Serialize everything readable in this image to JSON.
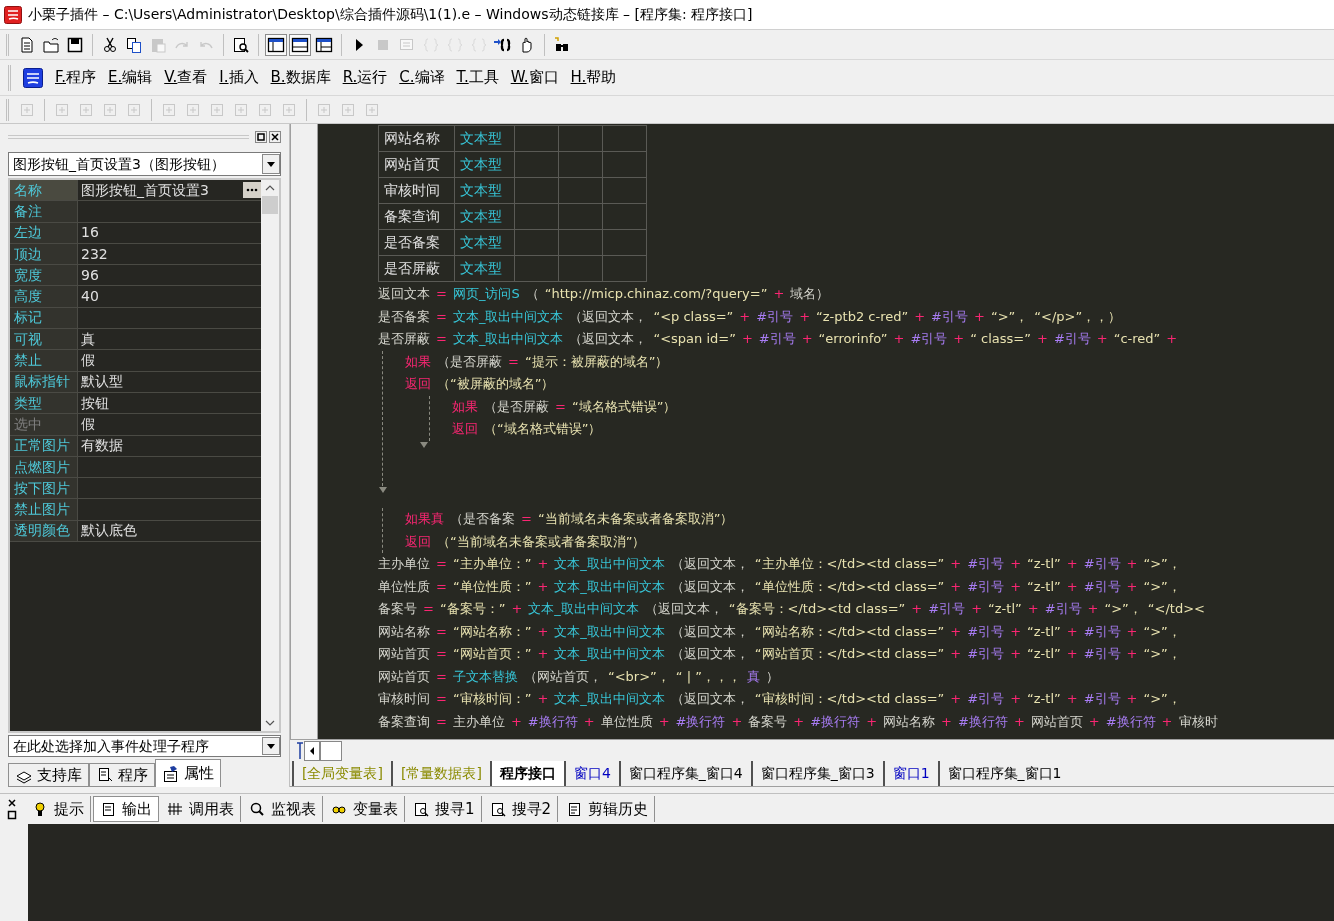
{
  "window": {
    "title": "小栗子插件 – C:\\Users\\Administrator\\Desktop\\综合插件源码\\1(1).e – Windows动态链接库 – [程序集: 程序接口]"
  },
  "toolbar": {
    "groups": [
      [
        {
          "disabled": false
        },
        {
          "disabled": false
        },
        {
          "disabled": false
        }
      ],
      [
        {
          "disabled": false
        },
        {
          "disabled": false
        },
        {
          "disabled": true
        },
        {
          "disabled": true
        },
        {
          "disabled": true
        }
      ],
      [
        {
          "disabled": false
        }
      ],
      [
        {
          "disabled": false,
          "selected": true
        },
        {
          "disabled": false,
          "selected": true
        },
        {
          "disabled": false,
          "selected": false
        }
      ],
      [
        {
          "disabled": false
        },
        {
          "disabled": true
        },
        {
          "disabled": true
        },
        {
          "disabled": true
        },
        {
          "disabled": true
        },
        {
          "disabled": true
        },
        {
          "disabled": false
        },
        {
          "disabled": false
        }
      ],
      [
        {
          "disabled": false
        }
      ]
    ]
  },
  "menu": [
    "F.程序",
    "E.编辑",
    "V.查看",
    "I.插入",
    "B.数据库",
    "R.运行",
    "C.编译",
    "T.工具",
    "W.窗口",
    "H.帮助"
  ],
  "align_toolbar": {
    "groups": [
      [
        {
          "disabled": true
        }
      ],
      [
        {
          "disabled": true
        },
        {
          "disabled": true
        },
        {
          "disabled": true
        },
        {
          "disabled": true
        }
      ],
      [
        {
          "disabled": true
        },
        {
          "disabled": true
        },
        {
          "disabled": true
        },
        {
          "disabled": true
        },
        {
          "disabled": true
        },
        {
          "disabled": true
        }
      ],
      [
        {
          "disabled": true
        },
        {
          "disabled": true
        },
        {
          "disabled": true
        }
      ]
    ]
  },
  "properties_panel": {
    "object_selector": "图形按钮_首页设置3（图形按钮）",
    "rows": [
      {
        "name": "名称",
        "value": "图形按钮_首页设置3",
        "disabled": false,
        "selected": true,
        "ellipsis": true
      },
      {
        "name": "备注",
        "value": "",
        "disabled": false,
        "selected": false
      },
      {
        "name": "左边",
        "value": "16",
        "disabled": false,
        "selected": false
      },
      {
        "name": "顶边",
        "value": "232",
        "disabled": false,
        "selected": false
      },
      {
        "name": "宽度",
        "value": "96",
        "disabled": false,
        "selected": false
      },
      {
        "name": "高度",
        "value": "40",
        "disabled": false,
        "selected": false
      },
      {
        "name": "标记",
        "value": "",
        "disabled": false,
        "selected": false
      },
      {
        "name": "可视",
        "value": "真",
        "disabled": false,
        "selected": false
      },
      {
        "name": "禁止",
        "value": "假",
        "disabled": false,
        "selected": false
      },
      {
        "name": "鼠标指针",
        "value": "默认型",
        "disabled": false,
        "selected": false
      },
      {
        "name": "类型",
        "value": "按钮",
        "disabled": false,
        "selected": false
      },
      {
        "name": "选中",
        "value": "假",
        "disabled": true,
        "selected": false
      },
      {
        "name": "正常图片",
        "value": "有数据",
        "disabled": false,
        "selected": false
      },
      {
        "name": "点燃图片",
        "value": "",
        "disabled": false,
        "selected": false
      },
      {
        "name": "按下图片",
        "value": "",
        "disabled": false,
        "selected": false
      },
      {
        "name": "禁止图片",
        "value": "",
        "disabled": false,
        "selected": false
      },
      {
        "name": "透明颜色",
        "value": "默认底色",
        "disabled": false,
        "selected": false
      }
    ],
    "event_selector": "在此处选择加入事件处理子程序",
    "tabs": [
      {
        "label": "支持库",
        "selected": false
      },
      {
        "label": "程序",
        "selected": false
      },
      {
        "label": "属性",
        "selected": true
      }
    ]
  },
  "editor": {
    "table": {
      "rows": [
        {
          "name": "网站名称",
          "type": "文本型"
        },
        {
          "name": "网站首页",
          "type": "文本型"
        },
        {
          "name": "审核时间",
          "type": "文本型"
        },
        {
          "name": "备案查询",
          "type": "文本型"
        },
        {
          "name": "是否备案",
          "type": "文本型"
        },
        {
          "name": "是否屏蔽",
          "type": "文本型"
        }
      ]
    },
    "lines": [
      {
        "kind": "stmt",
        "tokens": [
          {
            "kind": "plain",
            "text": "返回文本"
          },
          {
            "kind": "op",
            "text": "="
          },
          {
            "kind": "func",
            "text": "网页_访问S"
          },
          {
            "kind": "plain",
            "text": "（"
          },
          {
            "kind": "str",
            "text": "“http://micp.chinaz.com/?query=”"
          },
          {
            "kind": "op",
            "text": "+"
          },
          {
            "kind": "plain",
            "text": "域名）"
          }
        ]
      },
      {
        "kind": "stmt",
        "tokens": [
          {
            "kind": "plain",
            "text": "是否备案"
          },
          {
            "kind": "op",
            "text": "="
          },
          {
            "kind": "func",
            "text": "文本_取出中间文本"
          },
          {
            "kind": "plain",
            "text": "（返回文本，"
          },
          {
            "kind": "str",
            "text": "“<p class=”"
          },
          {
            "kind": "op",
            "text": "+"
          },
          {
            "kind": "const",
            "text": "#引号"
          },
          {
            "kind": "op",
            "text": "+"
          },
          {
            "kind": "str",
            "text": "“z-ptb2 c-red”"
          },
          {
            "kind": "op",
            "text": "+"
          },
          {
            "kind": "const",
            "text": "#引号"
          },
          {
            "kind": "op",
            "text": "+"
          },
          {
            "kind": "str",
            "text": "“>”，"
          },
          {
            "kind": "str",
            "text": "“</p>”，，）"
          }
        ]
      },
      {
        "kind": "stmt",
        "tokens": [
          {
            "kind": "plain",
            "text": "是否屏蔽"
          },
          {
            "kind": "op",
            "text": "="
          },
          {
            "kind": "func",
            "text": "文本_取出中间文本"
          },
          {
            "kind": "plain",
            "text": "（返回文本，"
          },
          {
            "kind": "str",
            "text": "“<span id=”"
          },
          {
            "kind": "op",
            "text": "+"
          },
          {
            "kind": "const",
            "text": "#引号"
          },
          {
            "kind": "op",
            "text": "+"
          },
          {
            "kind": "str",
            "text": "“errorinfo”"
          },
          {
            "kind": "op",
            "text": "+"
          },
          {
            "kind": "const",
            "text": "#引号"
          },
          {
            "kind": "op",
            "text": "+"
          },
          {
            "kind": "str",
            "text": "“ class=”"
          },
          {
            "kind": "op",
            "text": "+"
          },
          {
            "kind": "const",
            "text": "#引号"
          },
          {
            "kind": "op",
            "text": "+"
          },
          {
            "kind": "str",
            "text": "“c-red”"
          },
          {
            "kind": "op",
            "text": "+"
          }
        ]
      },
      {
        "kind": "if",
        "tokens": [
          {
            "kind": "kw",
            "text": "如果"
          },
          {
            "kind": "plain",
            "text": "（是否屏蔽"
          },
          {
            "kind": "op",
            "text": "="
          },
          {
            "kind": "str",
            "text": "“提示：被屏蔽的域名”）"
          }
        ],
        "then": [
          {
            "kind": "stmt",
            "tokens": [
              {
                "kind": "kw",
                "text": "返回"
              },
              {
                "kind": "str",
                "text": "（“被屏蔽的域名”）"
              }
            ]
          }
        ],
        "else": [
          {
            "kind": "if",
            "tokens": [
              {
                "kind": "kw",
                "text": "如果"
              },
              {
                "kind": "plain",
                "text": "（是否屏蔽"
              },
              {
                "kind": "op",
                "text": "="
              },
              {
                "kind": "str",
                "text": "“域名格式错误”）"
              }
            ],
            "then": [
              {
                "kind": "stmt",
                "tokens": [
                  {
                    "kind": "kw",
                    "text": "返回"
                  },
                  {
                    "kind": "str",
                    "text": "（“域名格式错误”）"
                  }
                ]
              }
            ]
          }
        ]
      },
      {
        "kind": "if",
        "tokens": [
          {
            "kind": "kw",
            "text": "如果真"
          },
          {
            "kind": "plain",
            "text": "（是否备案"
          },
          {
            "kind": "op",
            "text": "="
          },
          {
            "kind": "str",
            "text": "“当前域名未备案或者备案取消”）"
          }
        ],
        "then": [
          {
            "kind": "stmt",
            "tokens": [
              {
                "kind": "kw",
                "text": "返回"
              },
              {
                "kind": "str",
                "text": "（“当前域名未备案或者备案取消”）"
              }
            ]
          }
        ]
      },
      {
        "kind": "stmt",
        "tokens": [
          {
            "kind": "plain",
            "text": "主办单位"
          },
          {
            "kind": "op",
            "text": "="
          },
          {
            "kind": "str",
            "text": "“主办单位：”"
          },
          {
            "kind": "op",
            "text": "+"
          },
          {
            "kind": "func",
            "text": "文本_取出中间文本"
          },
          {
            "kind": "plain",
            "text": "（返回文本，"
          },
          {
            "kind": "str",
            "text": "“主办单位：</td><td class=”"
          },
          {
            "kind": "op",
            "text": "+"
          },
          {
            "kind": "const",
            "text": "#引号"
          },
          {
            "kind": "op",
            "text": "+"
          },
          {
            "kind": "str",
            "text": "“z-tl”"
          },
          {
            "kind": "op",
            "text": "+"
          },
          {
            "kind": "const",
            "text": "#引号"
          },
          {
            "kind": "op",
            "text": "+"
          },
          {
            "kind": "str",
            "text": "“>”，"
          }
        ]
      },
      {
        "kind": "stmt",
        "tokens": [
          {
            "kind": "plain",
            "text": "单位性质"
          },
          {
            "kind": "op",
            "text": "="
          },
          {
            "kind": "str",
            "text": "“单位性质：”"
          },
          {
            "kind": "op",
            "text": "+"
          },
          {
            "kind": "func",
            "text": "文本_取出中间文本"
          },
          {
            "kind": "plain",
            "text": "（返回文本，"
          },
          {
            "kind": "str",
            "text": "“单位性质：</td><td class=”"
          },
          {
            "kind": "op",
            "text": "+"
          },
          {
            "kind": "const",
            "text": "#引号"
          },
          {
            "kind": "op",
            "text": "+"
          },
          {
            "kind": "str",
            "text": "“z-tl”"
          },
          {
            "kind": "op",
            "text": "+"
          },
          {
            "kind": "const",
            "text": "#引号"
          },
          {
            "kind": "op",
            "text": "+"
          },
          {
            "kind": "str",
            "text": "“>”，"
          }
        ]
      },
      {
        "kind": "stmt",
        "tokens": [
          {
            "kind": "plain",
            "text": "备案号"
          },
          {
            "kind": "op",
            "text": "="
          },
          {
            "kind": "str",
            "text": "“备案号：”"
          },
          {
            "kind": "op",
            "text": "+"
          },
          {
            "kind": "func",
            "text": "文本_取出中间文本"
          },
          {
            "kind": "plain",
            "text": "（返回文本，"
          },
          {
            "kind": "str",
            "text": "“备案号：</td><td class=”"
          },
          {
            "kind": "op",
            "text": "+"
          },
          {
            "kind": "const",
            "text": "#引号"
          },
          {
            "kind": "op",
            "text": "+"
          },
          {
            "kind": "str",
            "text": "“z-tl”"
          },
          {
            "kind": "op",
            "text": "+"
          },
          {
            "kind": "const",
            "text": "#引号"
          },
          {
            "kind": "op",
            "text": "+"
          },
          {
            "kind": "str",
            "text": "“>”，"
          },
          {
            "kind": "str",
            "text": "“</td><"
          }
        ]
      },
      {
        "kind": "stmt",
        "tokens": [
          {
            "kind": "plain",
            "text": "网站名称"
          },
          {
            "kind": "op",
            "text": "="
          },
          {
            "kind": "str",
            "text": "“网站名称：”"
          },
          {
            "kind": "op",
            "text": "+"
          },
          {
            "kind": "func",
            "text": "文本_取出中间文本"
          },
          {
            "kind": "plain",
            "text": "（返回文本，"
          },
          {
            "kind": "str",
            "text": "“网站名称：</td><td class=”"
          },
          {
            "kind": "op",
            "text": "+"
          },
          {
            "kind": "const",
            "text": "#引号"
          },
          {
            "kind": "op",
            "text": "+"
          },
          {
            "kind": "str",
            "text": "“z-tl”"
          },
          {
            "kind": "op",
            "text": "+"
          },
          {
            "kind": "const",
            "text": "#引号"
          },
          {
            "kind": "op",
            "text": "+"
          },
          {
            "kind": "str",
            "text": "“>”，"
          }
        ]
      },
      {
        "kind": "stmt",
        "tokens": [
          {
            "kind": "plain",
            "text": "网站首页"
          },
          {
            "kind": "op",
            "text": "="
          },
          {
            "kind": "str",
            "text": "“网站首页：”"
          },
          {
            "kind": "op",
            "text": "+"
          },
          {
            "kind": "func",
            "text": "文本_取出中间文本"
          },
          {
            "kind": "plain",
            "text": "（返回文本，"
          },
          {
            "kind": "str",
            "text": "“网站首页：</td><td class=”"
          },
          {
            "kind": "op",
            "text": "+"
          },
          {
            "kind": "const",
            "text": "#引号"
          },
          {
            "kind": "op",
            "text": "+"
          },
          {
            "kind": "str",
            "text": "“z-tl”"
          },
          {
            "kind": "op",
            "text": "+"
          },
          {
            "kind": "const",
            "text": "#引号"
          },
          {
            "kind": "op",
            "text": "+"
          },
          {
            "kind": "str",
            "text": "“>”，"
          }
        ]
      },
      {
        "kind": "stmt",
        "tokens": [
          {
            "kind": "plain",
            "text": "网站首页"
          },
          {
            "kind": "op",
            "text": "="
          },
          {
            "kind": "func",
            "text": "子文本替换"
          },
          {
            "kind": "plain",
            "text": "（网站首页，"
          },
          {
            "kind": "str",
            "text": "“<br>”，"
          },
          {
            "kind": "str",
            "text": "“ | ”，，，"
          },
          {
            "kind": "const",
            "text": "真"
          },
          {
            "kind": "plain",
            "text": "）"
          }
        ]
      },
      {
        "kind": "stmt",
        "tokens": [
          {
            "kind": "plain",
            "text": "审核时间"
          },
          {
            "kind": "op",
            "text": "="
          },
          {
            "kind": "str",
            "text": "“审核时间：”"
          },
          {
            "kind": "op",
            "text": "+"
          },
          {
            "kind": "func",
            "text": "文本_取出中间文本"
          },
          {
            "kind": "plain",
            "text": "（返回文本，"
          },
          {
            "kind": "str",
            "text": "“审核时间：</td><td class=”"
          },
          {
            "kind": "op",
            "text": "+"
          },
          {
            "kind": "const",
            "text": "#引号"
          },
          {
            "kind": "op",
            "text": "+"
          },
          {
            "kind": "str",
            "text": "“z-tl”"
          },
          {
            "kind": "op",
            "text": "+"
          },
          {
            "kind": "const",
            "text": "#引号"
          },
          {
            "kind": "op",
            "text": "+"
          },
          {
            "kind": "str",
            "text": "“>”，"
          }
        ]
      },
      {
        "kind": "stmt",
        "tokens": [
          {
            "kind": "plain",
            "text": "备案查询"
          },
          {
            "kind": "op",
            "text": "="
          },
          {
            "kind": "plain",
            "text": "主办单位"
          },
          {
            "kind": "op",
            "text": "+"
          },
          {
            "kind": "const",
            "text": "#换行符"
          },
          {
            "kind": "op",
            "text": "+"
          },
          {
            "kind": "plain",
            "text": "单位性质"
          },
          {
            "kind": "op",
            "text": "+"
          },
          {
            "kind": "const",
            "text": "#换行符"
          },
          {
            "kind": "op",
            "text": "+"
          },
          {
            "kind": "plain",
            "text": "备案号"
          },
          {
            "kind": "op",
            "text": "+"
          },
          {
            "kind": "const",
            "text": "#换行符"
          },
          {
            "kind": "op",
            "text": "+"
          },
          {
            "kind": "plain",
            "text": "网站名称"
          },
          {
            "kind": "op",
            "text": "+"
          },
          {
            "kind": "const",
            "text": "#换行符"
          },
          {
            "kind": "op",
            "text": "+"
          },
          {
            "kind": "plain",
            "text": "网站首页"
          },
          {
            "kind": "op",
            "text": "+"
          },
          {
            "kind": "const",
            "text": "#换行符"
          },
          {
            "kind": "op",
            "text": "+"
          },
          {
            "kind": "plain",
            "text": "审核时"
          }
        ]
      }
    ],
    "tabs": [
      {
        "label": "[全局变量表]",
        "color": "#8a8a00",
        "selected": false
      },
      {
        "label": "[常量数据表]",
        "color": "#8a8a00",
        "selected": false
      },
      {
        "label": "程序接口",
        "color": "#000000",
        "selected": true
      },
      {
        "label": "窗口4",
        "color": "#0000c0",
        "selected": false
      },
      {
        "label": "窗口程序集_窗口4",
        "color": "#000000",
        "selected": false
      },
      {
        "label": "窗口程序集_窗口3",
        "color": "#000000",
        "selected": false
      },
      {
        "label": "窗口1",
        "color": "#0000c0",
        "selected": false
      },
      {
        "label": "窗口程序集_窗口1",
        "color": "#000000",
        "selected": false
      }
    ]
  },
  "output_panel": {
    "tabs": [
      {
        "label": "提示",
        "selected": false
      },
      {
        "label": "输出",
        "selected": true
      },
      {
        "label": "调用表",
        "selected": false
      },
      {
        "label": "监视表",
        "selected": false
      },
      {
        "label": "变量表",
        "selected": false
      },
      {
        "label": "搜寻1",
        "selected": false
      },
      {
        "label": "搜寻2",
        "selected": false
      },
      {
        "label": "剪辑历史",
        "selected": false
      }
    ]
  }
}
